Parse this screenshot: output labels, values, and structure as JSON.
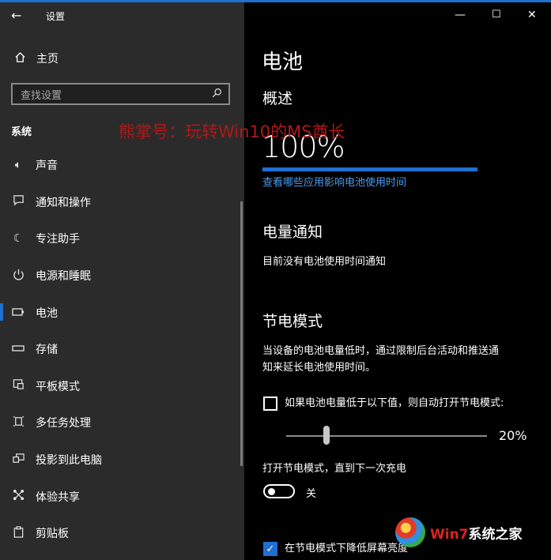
{
  "window": {
    "title": "设置",
    "back_glyph": "←",
    "minimize_glyph": "—",
    "maximize_glyph": "☐",
    "close_glyph": "✕"
  },
  "sidebar": {
    "home_label": "主页",
    "search_placeholder": "查找设置",
    "section_label": "系统",
    "items": [
      {
        "label": "声音",
        "icon": "sound-icon"
      },
      {
        "label": "通知和操作",
        "icon": "notification-icon"
      },
      {
        "label": "专注助手",
        "icon": "focus-assist-icon"
      },
      {
        "label": "电源和睡眠",
        "icon": "power-icon"
      },
      {
        "label": "电池",
        "icon": "battery-icon",
        "selected": true
      },
      {
        "label": "存储",
        "icon": "storage-icon"
      },
      {
        "label": "平板模式",
        "icon": "tablet-mode-icon"
      },
      {
        "label": "多任务处理",
        "icon": "multitasking-icon"
      },
      {
        "label": "投影到此电脑",
        "icon": "projecting-icon"
      },
      {
        "label": "体验共享",
        "icon": "shared-experiences-icon"
      },
      {
        "label": "剪贴板",
        "icon": "clipboard-icon"
      }
    ]
  },
  "content": {
    "title": "电池",
    "overview": {
      "heading": "概述",
      "percent_text": "100%",
      "battery_level": 1.0,
      "link": "查看哪些应用影响电池使用时间"
    },
    "notifications": {
      "heading": "电量通知",
      "text": "目前没有电池使用时间通知"
    },
    "saver": {
      "heading": "节电模式",
      "description_line1": "当设备的电池电量低时，通过限制后台活动和推送通",
      "description_line2": "知来延长电池使用时间。",
      "auto_checkbox_label": "如果电池电量低于以下值，则自动打开节电模式:",
      "auto_checked": false,
      "threshold_text": "20%",
      "threshold_value": 0.2,
      "toggle_caption": "打开节电模式，直到下一次充电",
      "toggle_state": "关",
      "brightness_checkbox_label": "在节电模式下降低屏幕亮度",
      "brightness_checked": true
    }
  },
  "watermarks": {
    "red_text": "熊掌号：玩转Win10的MS酋长",
    "logo_text_red": "Win7",
    "logo_text_white": "系统之家"
  },
  "colors": {
    "accent": "#1f6fd1",
    "link": "#4d9cf0",
    "sidebar_bg": "#2b2b2b",
    "content_bg": "#000000"
  }
}
